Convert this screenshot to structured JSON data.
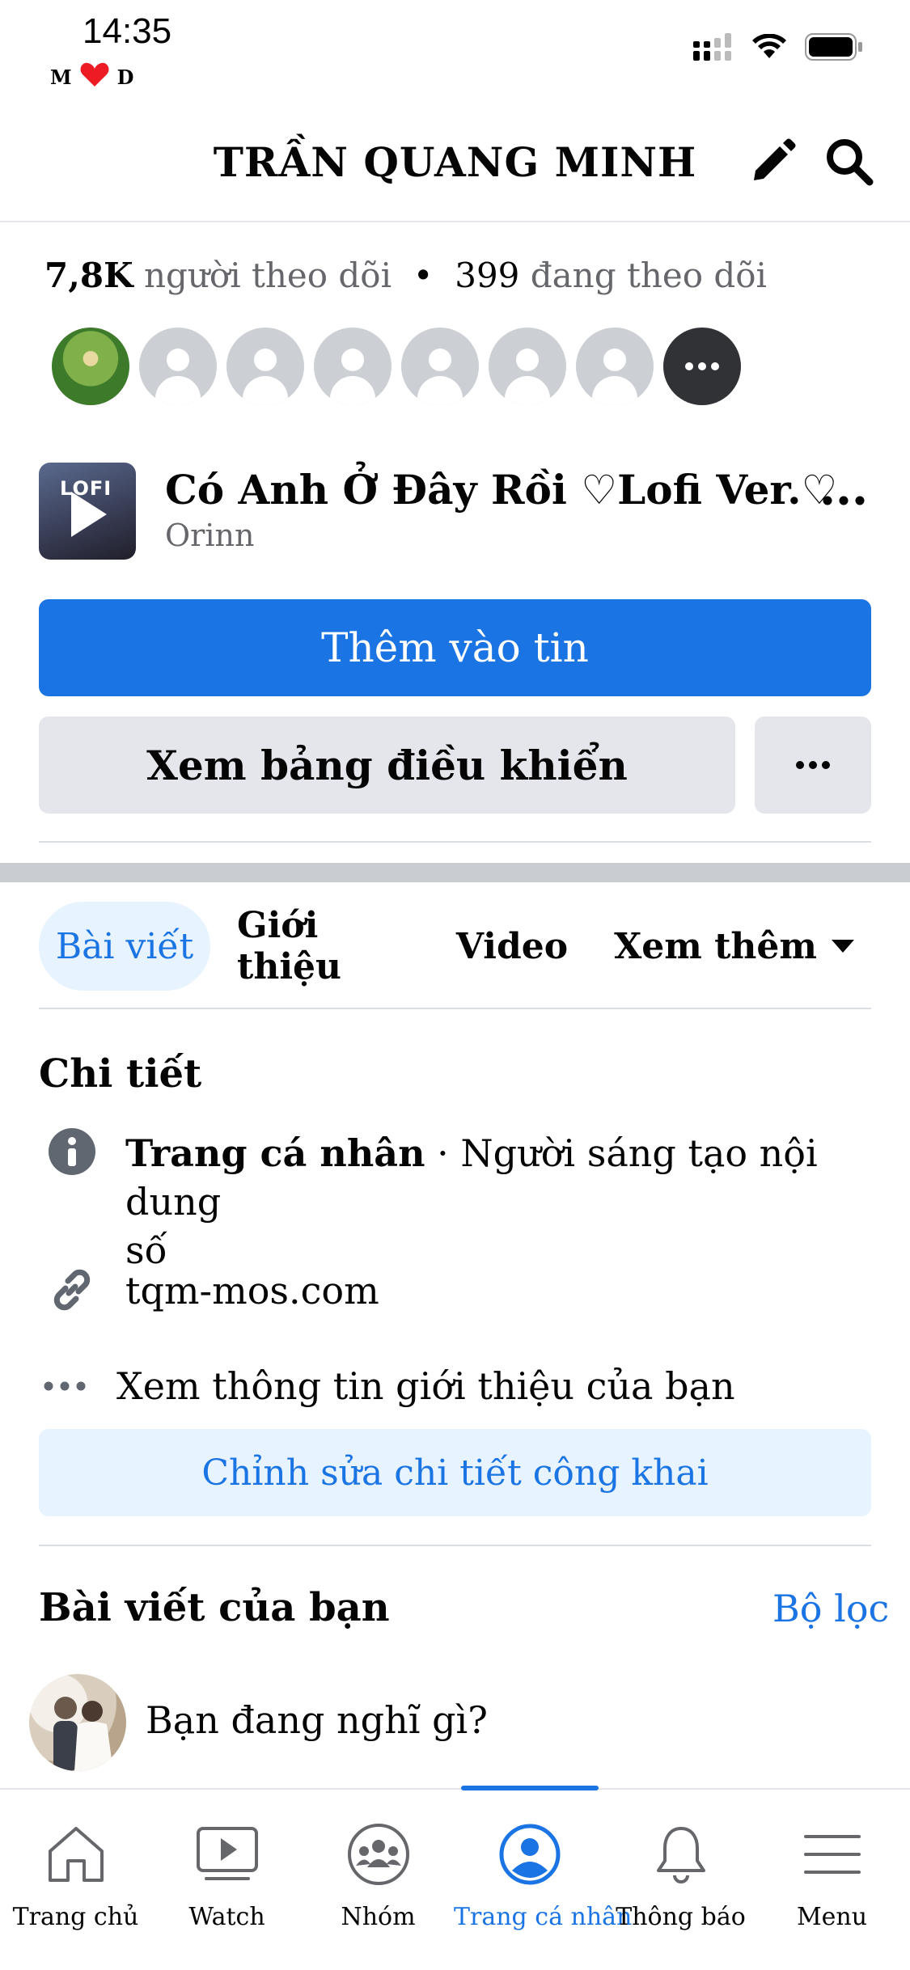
{
  "status_bar": {
    "time": "14:35",
    "carrier_left": "M",
    "carrier_right": "D"
  },
  "header": {
    "title": "TRẦN QUANG MINH"
  },
  "followers": {
    "count": "7,8K",
    "followers_label": "người theo dõi",
    "separator": "•",
    "following_count": "399",
    "following_label": "đang theo dõi"
  },
  "music": {
    "thumb_label": "LOFI",
    "title": "Có Anh Ở Đây Rồi ♡Lofi Ver.♡",
    "artist": "Orinn"
  },
  "buttons": {
    "add_to_story": "Thêm vào tin",
    "view_dashboard": "Xem bảng điều khiển"
  },
  "tabs": [
    {
      "label": "Bài viết"
    },
    {
      "label": "Giới thiệu"
    },
    {
      "label": "Video"
    },
    {
      "label": "Xem thêm"
    }
  ],
  "details": {
    "title": "Chi tiết",
    "profile_type_bold": "Trang cá nhân",
    "profile_type_rest": " · Người sáng tạo nội dung",
    "profile_type_rest2": "số",
    "website": "tqm-mos.com",
    "see_about": "Xem thông tin giới thiệu của bạn",
    "edit_public": "Chỉnh sửa chi tiết công khai"
  },
  "posts": {
    "title": "Bài viết của bạn",
    "filter": "Bộ lọc",
    "composer_placeholder": "Bạn đang nghĩ gì?"
  },
  "bottom_nav": [
    {
      "label": "Trang chủ",
      "icon": "home-icon"
    },
    {
      "label": "Watch",
      "icon": "watch-icon"
    },
    {
      "label": "Nhóm",
      "icon": "groups-icon"
    },
    {
      "label": "Trang cá nhân",
      "icon": "profile-icon"
    },
    {
      "label": "Thông báo",
      "icon": "bell-icon"
    },
    {
      "label": "Menu",
      "icon": "menu-icon"
    }
  ],
  "colors": {
    "accent": "#1b74e4",
    "muted": "#65676b",
    "secondary_bg": "#e4e6eb",
    "light_blue": "#e7f3ff"
  }
}
